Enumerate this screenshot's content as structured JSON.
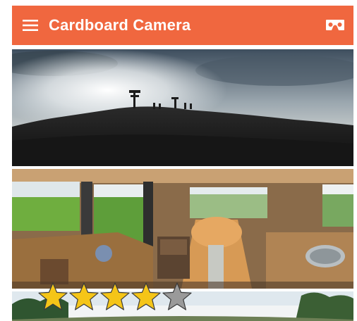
{
  "colors": {
    "accent": "#f0673f",
    "star_filled": "#f5c518",
    "star_empty": "#9a9a9a"
  },
  "appbar": {
    "title": "Cardboard Camera",
    "menu_icon": "hamburger-menu-icon",
    "vr_icon": "cardboard-vr-icon"
  },
  "gallery": {
    "items": [
      {
        "name": "mountain-summit-panorama"
      },
      {
        "name": "camper-van-interior-panorama"
      },
      {
        "name": "forest-landscape-panorama"
      }
    ]
  },
  "rating": {
    "value": 4,
    "max": 5
  }
}
